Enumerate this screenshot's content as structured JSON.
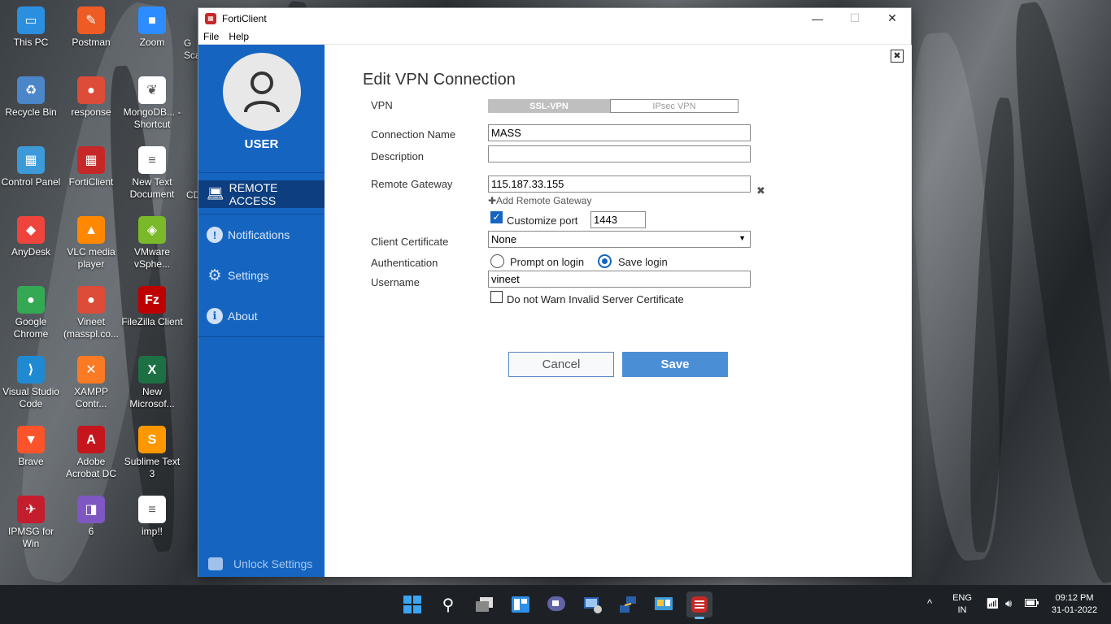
{
  "desktop": {
    "icons": [
      {
        "label": "This PC",
        "color": "#2b8fe0",
        "glyph": "▭"
      },
      {
        "label": "Postman",
        "color": "#ef5b25",
        "glyph": "✎"
      },
      {
        "label": "Zoom",
        "color": "#2d8cff",
        "glyph": "■"
      },
      {
        "label": "Recycle Bin",
        "color": "#4b86c9",
        "glyph": "♻"
      },
      {
        "label": "response",
        "color": "#dd4b39",
        "glyph": "●"
      },
      {
        "label": "MongoDB... - Shortcut",
        "color": "#ffffff",
        "glyph": "❦"
      },
      {
        "label": "Control Panel",
        "color": "#3d9ad8",
        "glyph": "▦"
      },
      {
        "label": "FortiClient",
        "color": "#c62828",
        "glyph": "▦"
      },
      {
        "label": "New Text Document",
        "color": "#ffffff",
        "glyph": "≡"
      },
      {
        "label": "AnyDesk",
        "color": "#ef443b",
        "glyph": "◆"
      },
      {
        "label": "VLC media player",
        "color": "#ff8800",
        "glyph": "▲"
      },
      {
        "label": "VMware vSphe...",
        "color": "#7ab929",
        "glyph": "◈"
      },
      {
        "label": "Google Chrome",
        "color": "#34a853",
        "glyph": "●"
      },
      {
        "label": "Vineet (masspl.co...",
        "color": "#dd4b39",
        "glyph": "●"
      },
      {
        "label": "FileZilla Client",
        "color": "#bf0000",
        "glyph": "Fz"
      },
      {
        "label": "Visual Studio Code",
        "color": "#1f8ad2",
        "glyph": "⟩"
      },
      {
        "label": "XAMPP Contr...",
        "color": "#fb7a24",
        "glyph": "✕"
      },
      {
        "label": "New Microsof...",
        "color": "#1d7044",
        "glyph": "X"
      },
      {
        "label": "Brave",
        "color": "#fb542b",
        "glyph": "▼"
      },
      {
        "label": "Adobe Acrobat DC",
        "color": "#c4161c",
        "glyph": "A"
      },
      {
        "label": "Sublime Text 3",
        "color": "#ff9800",
        "glyph": "S"
      },
      {
        "label": "IPMSG for Win",
        "color": "#c41d2d",
        "glyph": "✈"
      },
      {
        "label": "6",
        "color": "#7e57c2",
        "glyph": "◨"
      },
      {
        "label": "imp!!",
        "color": "#ffffff",
        "glyph": "≡"
      }
    ],
    "partial_left": {
      "g": "G",
      "sca": "Sca",
      "cd": "CD"
    }
  },
  "window": {
    "title": "FortiClient",
    "minimize": "—",
    "maximize": "☐",
    "close": "✕",
    "menu": {
      "file": "File",
      "help": "Help"
    }
  },
  "sidebar": {
    "user_label": "USER",
    "nav": [
      {
        "label": "REMOTE ACCESS",
        "icon": "laptop-icon"
      },
      {
        "label": "Notifications",
        "icon": "exclamation-icon"
      },
      {
        "label": "Settings",
        "icon": "gear-icon"
      },
      {
        "label": "About",
        "icon": "info-icon"
      }
    ],
    "unlock": "Unlock Settings"
  },
  "form": {
    "heading": "Edit VPN Connection",
    "labels": {
      "vpn": "VPN",
      "connection_name": "Connection Name",
      "description": "Description",
      "remote_gateway": "Remote Gateway",
      "client_certificate": "Client Certificate",
      "authentication": "Authentication",
      "username": "Username"
    },
    "vpn_options": {
      "ssl": "SSL-VPN",
      "ipsec": "IPsec VPN",
      "selected": "SSL-VPN"
    },
    "connection_name": "MASS",
    "description": "",
    "remote_gateway": "115.187.33.155",
    "add_remote_gateway": "✚Add Remote Gateway",
    "customize_port": {
      "label": "Customize port",
      "checked": true,
      "value": "1443"
    },
    "client_certificate": "None",
    "auth_options": {
      "prompt": "Prompt on login",
      "save": "Save login",
      "selected": "Save login"
    },
    "username": "vineet",
    "no_warn": {
      "label": "Do not Warn Invalid Server Certificate",
      "checked": false
    },
    "cancel": "Cancel",
    "save": "Save"
  },
  "taskbar": {
    "lang": "ENG",
    "region": "IN",
    "time": "09:12 PM",
    "date": "31-01-2022",
    "tray_chevron": "^"
  }
}
